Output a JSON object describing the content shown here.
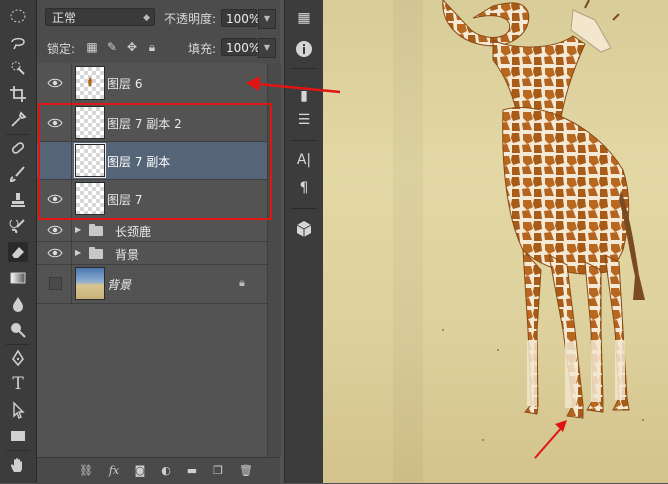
{
  "toolbar": {
    "tools": [
      "marquee-icon",
      "lasso-icon",
      "quick-select-icon",
      "crop-icon",
      "eyedropper-icon",
      "healing-icon",
      "brush-icon",
      "stamp-icon",
      "history-brush-icon",
      "eraser-icon",
      "gradient-icon",
      "blur-icon",
      "dodge-icon",
      "pen-icon",
      "type-icon",
      "path-select-icon",
      "shape-icon",
      "hand-icon"
    ]
  },
  "layers_panel": {
    "blend_mode": "正常",
    "opacity_label": "不透明度:",
    "opacity_value": "100%",
    "lock_label": "锁定:",
    "fill_label": "填充:",
    "fill_value": "100%",
    "layers": [
      {
        "name": "图层 6",
        "visible": true,
        "selected": false,
        "type": "layer"
      },
      {
        "name": "图层 7 副本 2",
        "visible": true,
        "selected": false,
        "type": "layer"
      },
      {
        "name": "图层 7 副本",
        "visible": false,
        "selected": true,
        "type": "layer"
      },
      {
        "name": "图层 7",
        "visible": true,
        "selected": false,
        "type": "layer"
      },
      {
        "name": "长颈鹿",
        "visible": true,
        "selected": false,
        "type": "group"
      },
      {
        "name": "背景",
        "visible": true,
        "selected": false,
        "type": "group"
      },
      {
        "name": "背景",
        "visible": false,
        "selected": false,
        "type": "background",
        "locked": true
      }
    ],
    "bottom_icons": [
      "link-icon",
      "fx-icon",
      "mask-icon",
      "adjustment-icon",
      "folder-icon",
      "new-layer-icon",
      "trash-icon"
    ]
  },
  "dock": {
    "icons": [
      "swatches-icon",
      "info-icon",
      "brush-preset-icon",
      "adjust-icon",
      "character-icon",
      "paragraph-icon",
      "3d-icon"
    ],
    "character_label": "A|",
    "paragraph_label": "¶"
  },
  "annotation": {
    "highlight_color": "#e11414"
  }
}
